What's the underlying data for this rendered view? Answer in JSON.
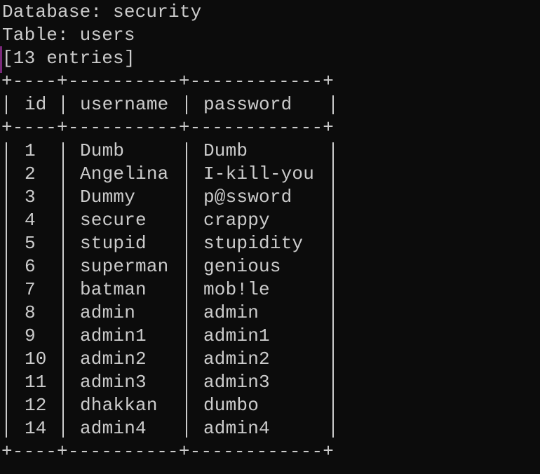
{
  "header": {
    "database_line": "Database: security",
    "table_line": "Table: users",
    "entries_line": "[13 entries]"
  },
  "table": {
    "border_line": "+----+----------+------------+",
    "columns": [
      "id",
      "username",
      "password"
    ],
    "rows": [
      {
        "id": "1",
        "username": "Dumb",
        "password": "Dumb"
      },
      {
        "id": "2",
        "username": "Angelina",
        "password": "I-kill-you"
      },
      {
        "id": "3",
        "username": "Dummy",
        "password": "p@ssword"
      },
      {
        "id": "4",
        "username": "secure",
        "password": "crappy"
      },
      {
        "id": "5",
        "username": "stupid",
        "password": "stupidity"
      },
      {
        "id": "6",
        "username": "superman",
        "password": "genious"
      },
      {
        "id": "7",
        "username": "batman",
        "password": "mob!le"
      },
      {
        "id": "8",
        "username": "admin",
        "password": "admin"
      },
      {
        "id": "9",
        "username": "admin1",
        "password": "admin1"
      },
      {
        "id": "10",
        "username": "admin2",
        "password": "admin2"
      },
      {
        "id": "11",
        "username": "admin3",
        "password": "admin3"
      },
      {
        "id": "12",
        "username": "dhakkan",
        "password": "dumbo"
      },
      {
        "id": "14",
        "username": "admin4",
        "password": "admin4"
      }
    ]
  },
  "colors": {
    "background": "#0c0c0c",
    "text": "#cccccc",
    "cursor_accent": "#7a2a7a"
  }
}
